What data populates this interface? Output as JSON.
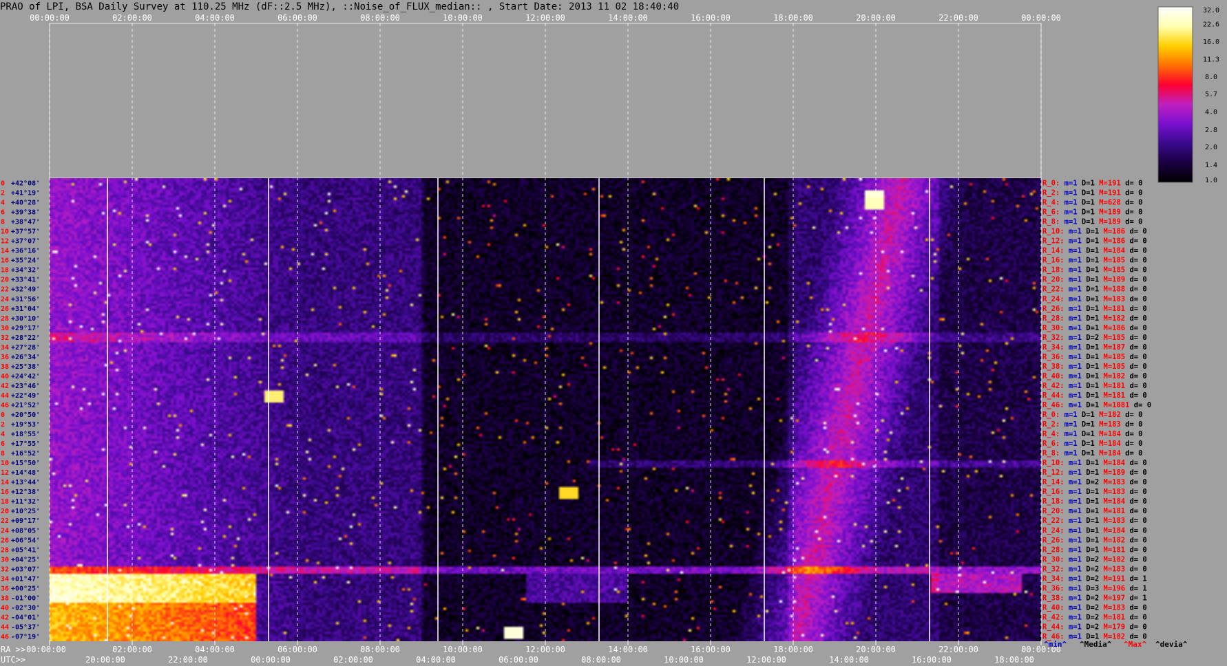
{
  "title": "PRAO of LPI, BSA Daily Survey at 110.25 MHz (dF::2.5 MHz), ::Noise_of_FLUX_median:: , Start Date: 2013 11 02 18:40:40",
  "chart_data": {
    "type": "heatmap",
    "title": "PRAO of LPI, BSA Daily Survey at 110.25 MHz (dF::2.5 MHz), ::Noise_of_FLUX_median:: , Start Date: 2013 11 02 18:40:40",
    "top_ticks": [
      "00:00:00",
      "02:00:00",
      "04:00:00",
      "06:00:00",
      "08:00:00",
      "10:00:00",
      "12:00:00",
      "14:00:00",
      "16:00:00",
      "18:00:00",
      "20:00:00",
      "22:00:00",
      "00:00:00"
    ],
    "ra_label": "RA >>",
    "ra_ticks": [
      "00:00:00",
      "02:00:00",
      "04:00:00",
      "06:00:00",
      "08:00:00",
      "10:00:00",
      "12:00:00",
      "14:00:00",
      "16:00:00",
      "18:00:00",
      "20:00:00",
      "22:00:00",
      "00:00:00"
    ],
    "utc_label": "UTC>>",
    "utc_ticks": [
      "20:00:00",
      "22:00:00",
      "00:00:00",
      "02:00:00",
      "04:00:00",
      "06:00:00",
      "08:00:00",
      "10:00:00",
      "12:00:00",
      "14:00:00",
      "16:00:00",
      "18:00:00"
    ],
    "x_range_hours": [
      0,
      24
    ],
    "declinations": [
      "+42°08'",
      "+41°19'",
      "+40°28'",
      "+39°38'",
      "+38°47'",
      "+37°57'",
      "+37°07'",
      "+36°16'",
      "+35°24'",
      "+34°32'",
      "+33°41'",
      "+32°49'",
      "+31°56'",
      "+31°04'",
      "+30°10'",
      "+29°17'",
      "+28°22'",
      "+27°28'",
      "+26°34'",
      "+25°38'",
      "+24°42'",
      "+23°46'",
      "+22°49'",
      "+21°52'",
      "+20°50'",
      "+19°53'",
      "+18°55'",
      "+17°55'",
      "+16°52'",
      "+15°50'",
      "+14°48'",
      "+13°44'",
      "+12°38'",
      "+11°32'",
      "+10°25'",
      "+09°17'",
      "+08°05'",
      "+06°54'",
      "+05°41'",
      "+04°25'",
      "+03°07'",
      "+01°47'",
      "+00°25'",
      "-01°00'",
      "-02°30'",
      "-04°01'",
      "-05°37'",
      "-07°19'"
    ],
    "beam_numbers": [
      "0",
      "2",
      "4",
      "6",
      "8",
      "10",
      "12",
      "14",
      "16",
      "18",
      "20",
      "22",
      "24",
      "26",
      "28",
      "30",
      "32",
      "34",
      "36",
      "38",
      "40",
      "42",
      "44",
      "46",
      "0",
      "2",
      "4",
      "6",
      "8",
      "10",
      "12",
      "14",
      "16",
      "18",
      "20",
      "22",
      "24",
      "26",
      "28",
      "30",
      "32",
      "34",
      "36",
      "38",
      "40",
      "42",
      "44",
      "46"
    ],
    "row_stats": [
      {
        "R": "R_0:",
        "min": "m=1",
        "D": "D=1",
        "M": "M=191",
        "d": "d= 0"
      },
      {
        "R": "R_2:",
        "min": "m=1",
        "D": "D=1",
        "M": "M=191",
        "d": "d= 0"
      },
      {
        "R": "R_4:",
        "min": "m=1",
        "D": "D=1",
        "M": "M=628",
        "d": "d= 0"
      },
      {
        "R": "R_6:",
        "min": "m=1",
        "D": "D=1",
        "M": "M=189",
        "d": "d= 0"
      },
      {
        "R": "R_8:",
        "min": "m=1",
        "D": "D=1",
        "M": "M=189",
        "d": "d= 0"
      },
      {
        "R": "R_10:",
        "min": "m=1",
        "D": "D=1",
        "M": "M=186",
        "d": "d= 0"
      },
      {
        "R": "R_12:",
        "min": "m=1",
        "D": "D=1",
        "M": "M=186",
        "d": "d= 0"
      },
      {
        "R": "R_14:",
        "min": "m=1",
        "D": "D=1",
        "M": "M=184",
        "d": "d= 0"
      },
      {
        "R": "R_16:",
        "min": "m=1",
        "D": "D=1",
        "M": "M=185",
        "d": "d= 0"
      },
      {
        "R": "R_18:",
        "min": "m=1",
        "D": "D=1",
        "M": "M=185",
        "d": "d= 0"
      },
      {
        "R": "R_20:",
        "min": "m=1",
        "D": "D=1",
        "M": "M=189",
        "d": "d= 0"
      },
      {
        "R": "R_22:",
        "min": "m=1",
        "D": "D=1",
        "M": "M=188",
        "d": "d= 0"
      },
      {
        "R": "R_24:",
        "min": "m=1",
        "D": "D=1",
        "M": "M=183",
        "d": "d= 0"
      },
      {
        "R": "R_26:",
        "min": "m=1",
        "D": "D=1",
        "M": "M=181",
        "d": "d= 0"
      },
      {
        "R": "R_28:",
        "min": "m=1",
        "D": "D=1",
        "M": "M=182",
        "d": "d= 0"
      },
      {
        "R": "R_30:",
        "min": "m=1",
        "D": "D=1",
        "M": "M=186",
        "d": "d= 0"
      },
      {
        "R": "R_32:",
        "min": "m=1",
        "D": "D=2",
        "M": "M=185",
        "d": "d= 0"
      },
      {
        "R": "R_34:",
        "min": "m=1",
        "D": "D=1",
        "M": "M=187",
        "d": "d= 0"
      },
      {
        "R": "R_36:",
        "min": "m=1",
        "D": "D=1",
        "M": "M=185",
        "d": "d= 0"
      },
      {
        "R": "R_38:",
        "min": "m=1",
        "D": "D=1",
        "M": "M=185",
        "d": "d= 0"
      },
      {
        "R": "R_40:",
        "min": "m=1",
        "D": "D=1",
        "M": "M=182",
        "d": "d= 0"
      },
      {
        "R": "R_42:",
        "min": "m=1",
        "D": "D=1",
        "M": "M=181",
        "d": "d= 0"
      },
      {
        "R": "R_44:",
        "min": "m=1",
        "D": "D=1",
        "M": "M=181",
        "d": "d= 0"
      },
      {
        "R": "R_46:",
        "min": "m=1",
        "D": "D=1",
        "M": "M=1081",
        "d": "d= 0"
      },
      {
        "R": "R_0:",
        "min": "m=1",
        "D": "D=1",
        "M": "M=182",
        "d": "d= 0"
      },
      {
        "R": "R_2:",
        "min": "m=1",
        "D": "D=1",
        "M": "M=183",
        "d": "d= 0"
      },
      {
        "R": "R_4:",
        "min": "m=1",
        "D": "D=1",
        "M": "M=184",
        "d": "d= 0"
      },
      {
        "R": "R_6:",
        "min": "m=1",
        "D": "D=1",
        "M": "M=184",
        "d": "d= 0"
      },
      {
        "R": "R_8:",
        "min": "m=1",
        "D": "D=1",
        "M": "M=184",
        "d": "d= 0"
      },
      {
        "R": "R_10:",
        "min": "m=1",
        "D": "D=1",
        "M": "M=184",
        "d": "d= 0"
      },
      {
        "R": "R_12:",
        "min": "m=1",
        "D": "D=1",
        "M": "M=189",
        "d": "d= 0"
      },
      {
        "R": "R_14:",
        "min": "m=1",
        "D": "D=2",
        "M": "M=183",
        "d": "d= 0"
      },
      {
        "R": "R_16:",
        "min": "m=1",
        "D": "D=1",
        "M": "M=183",
        "d": "d= 0"
      },
      {
        "R": "R_18:",
        "min": "m=1",
        "D": "D=1",
        "M": "M=184",
        "d": "d= 0"
      },
      {
        "R": "R_20:",
        "min": "m=1",
        "D": "D=1",
        "M": "M=181",
        "d": "d= 0"
      },
      {
        "R": "R_22:",
        "min": "m=1",
        "D": "D=1",
        "M": "M=183",
        "d": "d= 0"
      },
      {
        "R": "R_24:",
        "min": "m=1",
        "D": "D=1",
        "M": "M=184",
        "d": "d= 0"
      },
      {
        "R": "R_26:",
        "min": "m=1",
        "D": "D=1",
        "M": "M=182",
        "d": "d= 0"
      },
      {
        "R": "R_28:",
        "min": "m=1",
        "D": "D=1",
        "M": "M=181",
        "d": "d= 0"
      },
      {
        "R": "R_30:",
        "min": "m=1",
        "D": "D=2",
        "M": "M=182",
        "d": "d= 0"
      },
      {
        "R": "R_32:",
        "min": "m=1",
        "D": "D=2",
        "M": "M=183",
        "d": "d= 0"
      },
      {
        "R": "R_34:",
        "min": "m=1",
        "D": "D=2",
        "M": "M=191",
        "d": "d= 1"
      },
      {
        "R": "R_36:",
        "min": "m=1",
        "D": "D=3",
        "M": "M=196",
        "d": "d= 1"
      },
      {
        "R": "R_38:",
        "min": "m=1",
        "D": "D=2",
        "M": "M=197",
        "d": "d= 1"
      },
      {
        "R": "R_40:",
        "min": "m=1",
        "D": "D=2",
        "M": "M=183",
        "d": "d= 0"
      },
      {
        "R": "R_42:",
        "min": "m=1",
        "D": "D=2",
        "M": "M=181",
        "d": "d= 0"
      },
      {
        "R": "R_44:",
        "min": "m=1",
        "D": "D=2",
        "M": "M=179",
        "d": "d= 0"
      },
      {
        "R": "R_46:",
        "min": "m=1",
        "D": "D=1",
        "M": "M=182",
        "d": "d= 0"
      }
    ],
    "colorbar_ticks": [
      "32.0",
      "22.6",
      "16.0",
      "11.3",
      "8.0",
      "5.7",
      "4.0",
      "2.8",
      "2.0",
      "1.4",
      "1.0"
    ],
    "colorbar_range": [
      1.0,
      32.0
    ],
    "colorbar_scale": "log",
    "colors": {
      "stat_r": "#ff0000",
      "stat_m": "#0000c0",
      "stat_d": "#000000",
      "stat_M": "#ff0000",
      "dec_text": "#000080",
      "beam_text": "#ff0000",
      "colormap": [
        "#000000",
        "#1a0040",
        "#3a0a8c",
        "#7a10d0",
        "#c020c0",
        "#ff0030",
        "#ff7000",
        "#ffd000",
        "#ffffb0",
        "#ffffff"
      ]
    }
  },
  "legend": {
    "min": "^min^",
    "median": "^Media^",
    "max": "^Max^",
    "dev": "^devia^"
  }
}
